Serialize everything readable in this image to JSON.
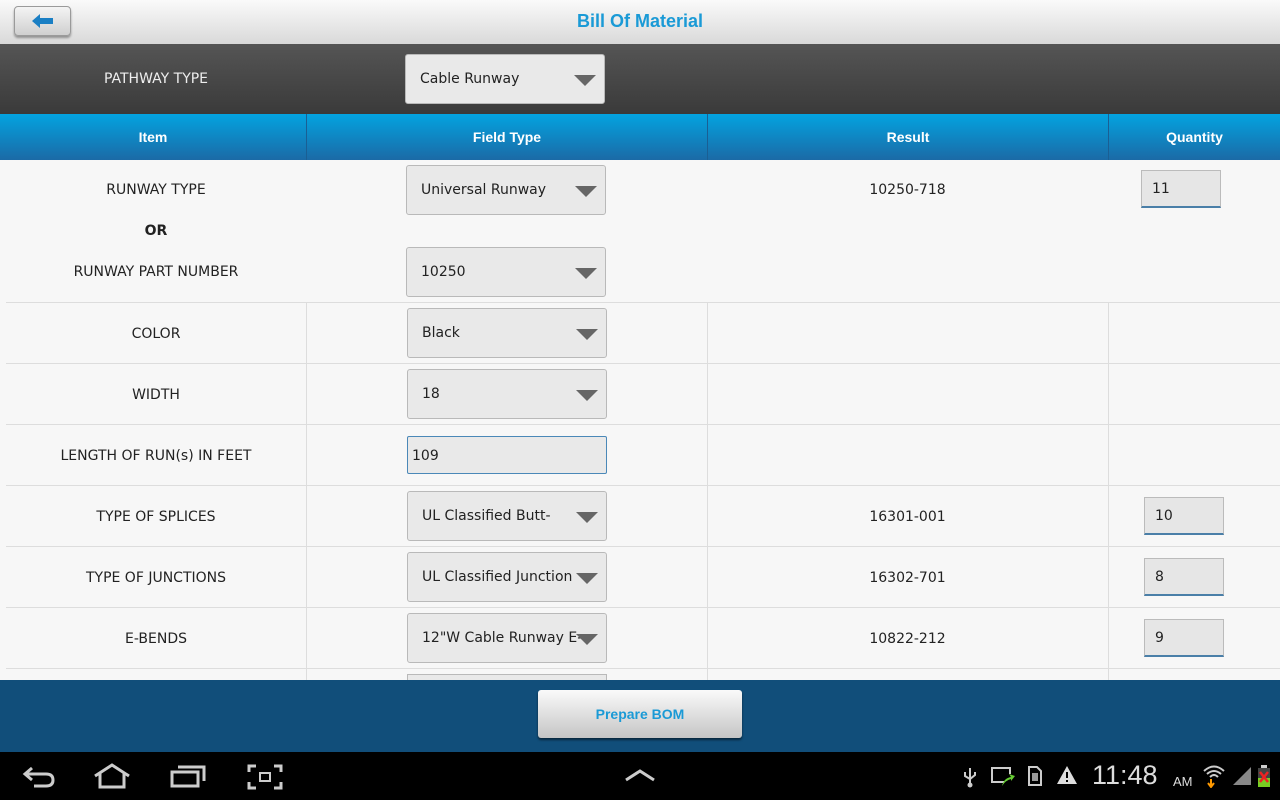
{
  "title": "Bill Of Material",
  "pathway": {
    "label": "PATHWAY TYPE",
    "value": "Cable Runway"
  },
  "columns": [
    "Item",
    "Field Type",
    "Result",
    "Quantity"
  ],
  "first": {
    "runway_type_label": "RUNWAY TYPE",
    "runway_type_value": "Universal Runway",
    "or_label": "OR",
    "part_label": "RUNWAY PART NUMBER",
    "part_value": "10250",
    "result": "10250-718",
    "quantity": "11"
  },
  "rows": [
    {
      "label": "COLOR",
      "value": "Black",
      "result": "",
      "quantity": ""
    },
    {
      "label": "WIDTH",
      "value": "18",
      "result": "",
      "quantity": ""
    },
    {
      "label": "LENGTH OF RUN(s) IN FEET",
      "value": "109",
      "result": "",
      "quantity": ""
    },
    {
      "label": "TYPE OF SPLICES",
      "value": "UL Classified Butt-",
      "result": "16301-001",
      "quantity": "10"
    },
    {
      "label": "TYPE OF JUNCTIONS",
      "value": "UL Classified Junction",
      "result": "16302-701",
      "quantity": "8"
    },
    {
      "label": "E-BENDS",
      "value": "12\"W Cable Runway E-",
      "result": "10822-212",
      "quantity": "9"
    }
  ],
  "footer": {
    "button": "Prepare BOM"
  },
  "status": {
    "time": "11:48",
    "ampm": "AM",
    "icons": [
      "usb-icon",
      "screen-mirror-icon",
      "sd-card-icon",
      "warning-icon",
      "wifi-icon",
      "signal-icon",
      "battery-icon"
    ]
  }
}
